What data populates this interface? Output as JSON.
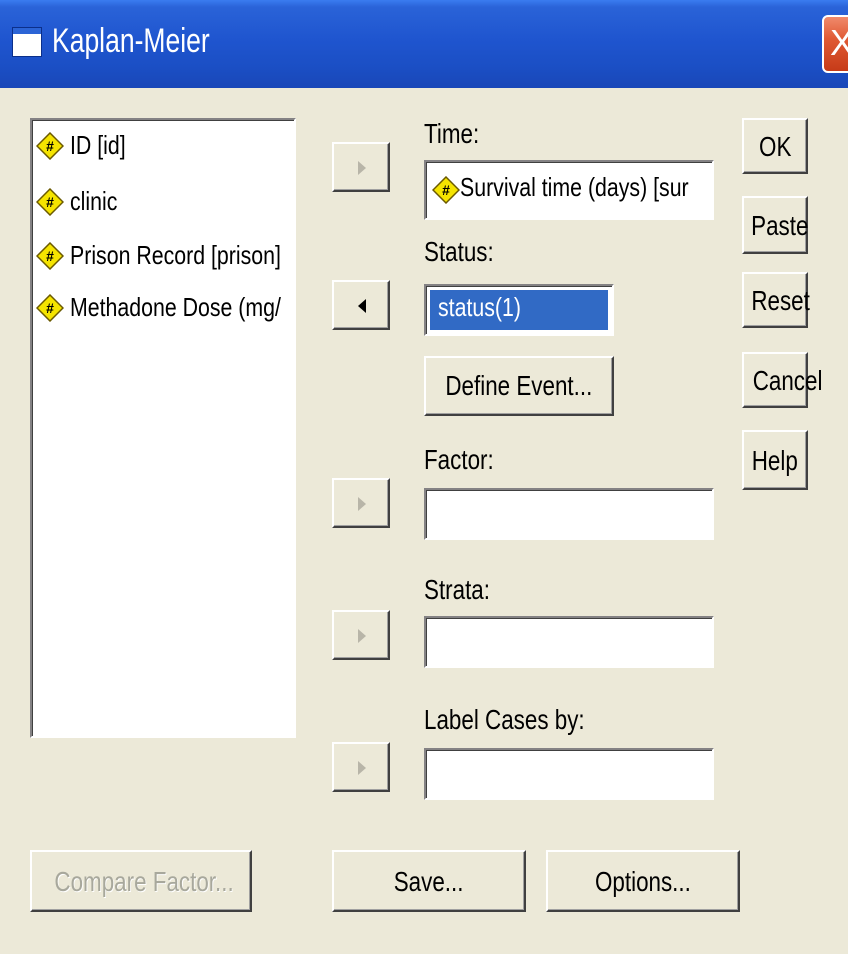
{
  "window": {
    "title": "Kaplan-Meier",
    "close_glyph": "X"
  },
  "variables": [
    {
      "label": "ID [id]",
      "icon": "numeric-variable-icon"
    },
    {
      "label": "clinic",
      "icon": "numeric-variable-icon"
    },
    {
      "label": "Prison Record [prison]",
      "icon": "numeric-variable-icon"
    },
    {
      "label": "Methadone Dose (mg/",
      "icon": "numeric-variable-icon"
    }
  ],
  "fields": {
    "time": {
      "label": "Time:",
      "value": "Survival time (days) [sur"
    },
    "status": {
      "label": "Status:",
      "value": "status(1)"
    },
    "factor": {
      "label": "Factor:",
      "value": ""
    },
    "strata": {
      "label": "Strata:",
      "value": ""
    },
    "label_cases": {
      "label": "Label Cases by:",
      "value": ""
    }
  },
  "buttons": {
    "define_event": "Define Event...",
    "ok": "OK",
    "paste": "Paste",
    "reset": "Reset",
    "cancel": "Cancel",
    "help": "Help",
    "compare_factor": "Compare Factor...",
    "save": "Save...",
    "options": "Options..."
  },
  "colors": {
    "titlebar": "#1f55cf",
    "dialog_bg": "#ece9d8",
    "selection": "#316ac5",
    "close_button": "#e05a34"
  }
}
